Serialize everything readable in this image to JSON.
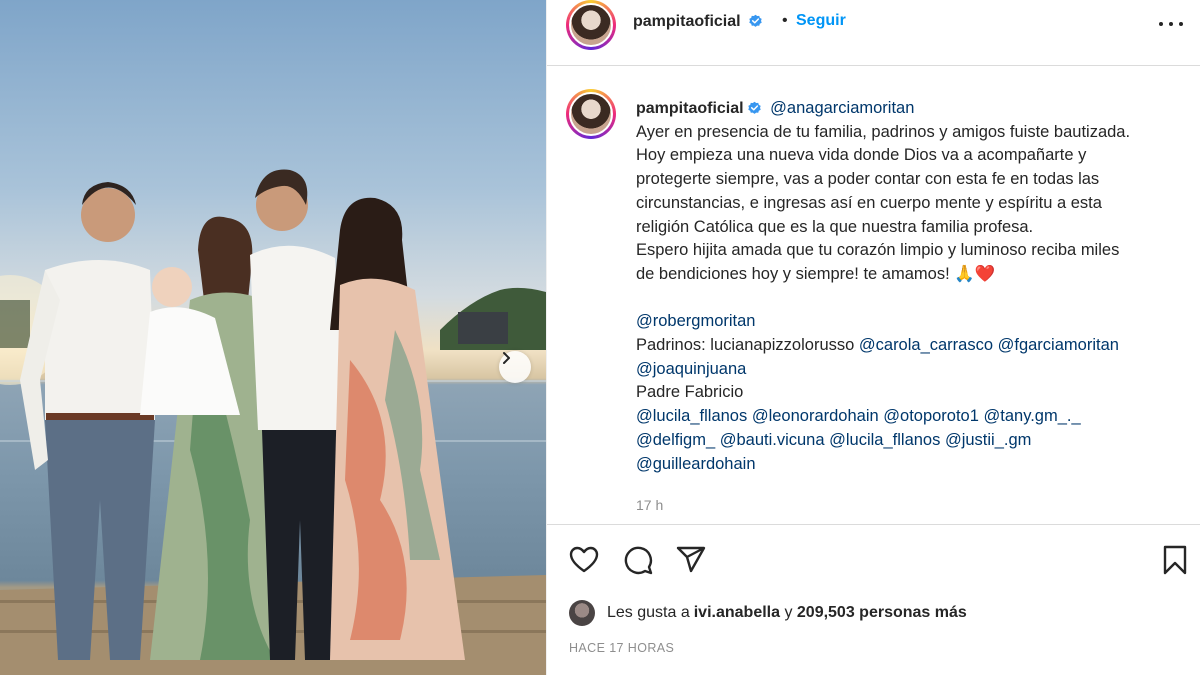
{
  "photo": {
    "alt": "",
    "next_icon": "chevron-right-icon"
  },
  "header": {
    "username": "pampitaoficial",
    "verified_icon": "verified-badge-icon",
    "separator": "•",
    "follow_label": "Seguir",
    "more_icon": "more-options-icon"
  },
  "caption": {
    "username": "pampitaoficial",
    "mention": "@anagarciamoritan",
    "lines": [
      "Ayer en presencia de tu familia, padrinos y amigos fuiste bautizada.",
      "Hoy empieza una nueva vida donde Dios va a acompañarte y",
      "protegerte siempre, vas a poder contar con esta fe en todas las",
      "circunstancias, e ingresas así en cuerpo mente y espíritu a esta",
      "religión Católica que es la que nuestra familia profesa.",
      "Espero hijita amada que tu corazón limpio y luminoso reciba miles",
      "de bendiciones hoy y siempre! te amamos! 🙏❤️"
    ],
    "tag_rober": "@robergmoritan",
    "padrinos_label": "Padrinos: ",
    "padrino_1": "lucianapizzolorusso",
    "padrino_2": "@carola_carrasco",
    "padrino_3": "@fgarciamoritan",
    "padrino_4": "@joaquinjuana",
    "padre": "Padre Fabricio",
    "tags_line1": [
      "@lucila_fllanos",
      "@leonorardohain",
      "@otoporoto1",
      "@tany.gm_._"
    ],
    "tags_line2": [
      "@delfigm_",
      "@bauti.vicuna",
      "@lucila_fllanos",
      "@justii_.gm"
    ],
    "tags_line3": [
      "@guilleardohain"
    ],
    "time": "17 h"
  },
  "actions": {
    "like_icon": "heart-icon",
    "comment_icon": "comment-icon",
    "share_icon": "share-icon",
    "save_icon": "bookmark-icon"
  },
  "likes": {
    "prefix": "Les gusta a ",
    "user": "ivi.anabella",
    "middle": " y ",
    "count": "209,503 personas más"
  },
  "timestamp": "HACE 17 HORAS"
}
